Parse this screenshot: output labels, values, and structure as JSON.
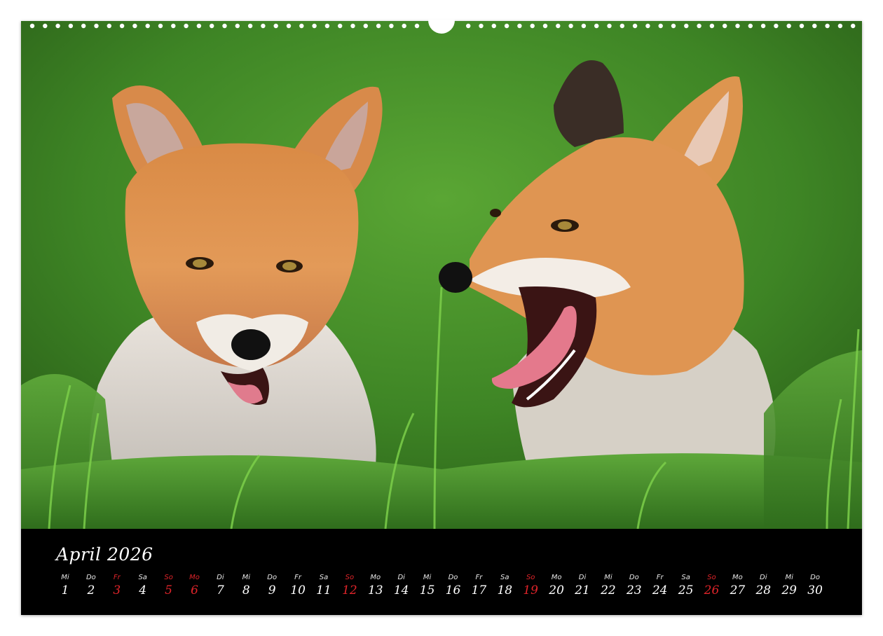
{
  "calendar": {
    "title": "April 2026",
    "accent_color": "#e0242a",
    "days": [
      {
        "dow": "Mi",
        "num": "1",
        "holiday": false
      },
      {
        "dow": "Do",
        "num": "2",
        "holiday": false
      },
      {
        "dow": "Fr",
        "num": "3",
        "holiday": true
      },
      {
        "dow": "Sa",
        "num": "4",
        "holiday": false
      },
      {
        "dow": "So",
        "num": "5",
        "holiday": true
      },
      {
        "dow": "Mo",
        "num": "6",
        "holiday": true
      },
      {
        "dow": "Di",
        "num": "7",
        "holiday": false
      },
      {
        "dow": "Mi",
        "num": "8",
        "holiday": false
      },
      {
        "dow": "Do",
        "num": "9",
        "holiday": false
      },
      {
        "dow": "Fr",
        "num": "10",
        "holiday": false
      },
      {
        "dow": "Sa",
        "num": "11",
        "holiday": false
      },
      {
        "dow": "So",
        "num": "12",
        "holiday": true
      },
      {
        "dow": "Mo",
        "num": "13",
        "holiday": false
      },
      {
        "dow": "Di",
        "num": "14",
        "holiday": false
      },
      {
        "dow": "Mi",
        "num": "15",
        "holiday": false
      },
      {
        "dow": "Do",
        "num": "16",
        "holiday": false
      },
      {
        "dow": "Fr",
        "num": "17",
        "holiday": false
      },
      {
        "dow": "Sa",
        "num": "18",
        "holiday": false
      },
      {
        "dow": "So",
        "num": "19",
        "holiday": true
      },
      {
        "dow": "Mo",
        "num": "20",
        "holiday": false
      },
      {
        "dow": "Di",
        "num": "21",
        "holiday": false
      },
      {
        "dow": "Mi",
        "num": "22",
        "holiday": false
      },
      {
        "dow": "Do",
        "num": "23",
        "holiday": false
      },
      {
        "dow": "Fr",
        "num": "24",
        "holiday": false
      },
      {
        "dow": "Sa",
        "num": "25",
        "holiday": false
      },
      {
        "dow": "So",
        "num": "26",
        "holiday": true
      },
      {
        "dow": "Mo",
        "num": "27",
        "holiday": false
      },
      {
        "dow": "Di",
        "num": "28",
        "holiday": false
      },
      {
        "dow": "Mi",
        "num": "29",
        "holiday": false
      },
      {
        "dow": "Do",
        "num": "30",
        "holiday": false
      }
    ]
  },
  "photo": {
    "subject": "fox-cubs-photo"
  }
}
